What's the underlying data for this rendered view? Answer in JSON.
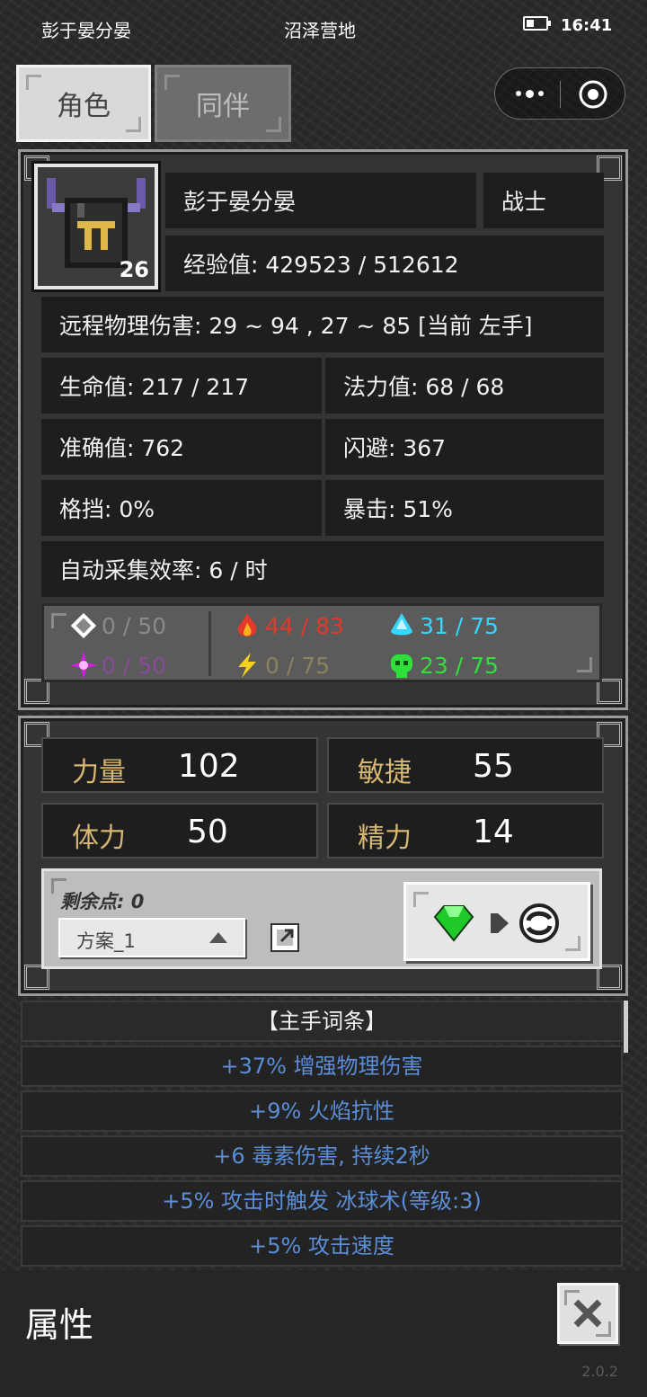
{
  "status_bar": {
    "app_title": "彭于晏分晏",
    "location": "沼泽营地",
    "time": "16:41"
  },
  "tabs": [
    {
      "label": "角色",
      "active": true
    },
    {
      "label": "同伴",
      "active": false
    }
  ],
  "character": {
    "name": "彭于晏分晏",
    "class": "战士",
    "level": "26",
    "exp": "经验值: 429523 / 512612",
    "damage": "远程物理伤害: 29 ~ 94 , 27 ~ 85 [当前 左手]",
    "hp": "生命值: 217 / 217",
    "mp": "法力值: 68 / 68",
    "accuracy": "准确值: 762",
    "dodge": "闪避: 367",
    "block": "格挡: 0%",
    "crit": "暴击: 51%",
    "gather": "自动采集效率: 6 / 时"
  },
  "resistances": [
    {
      "icon": "physical-resist-icon",
      "value": "0 / 50",
      "color": "#8a8a8a"
    },
    {
      "icon": "fire-icon",
      "value": "44 / 83",
      "color": "#e23a2a"
    },
    {
      "icon": "ice-drop-icon",
      "value": "31 / 75",
      "color": "#35d6ff"
    },
    {
      "icon": "arcane-star-icon",
      "value": "0 / 50",
      "color": "#8a4a9a"
    },
    {
      "icon": "lightning-icon",
      "value": "0 / 75",
      "color": "#8a8360"
    },
    {
      "icon": "poison-skull-icon",
      "value": "23 / 75",
      "color": "#2fe03a"
    }
  ],
  "attributes": {
    "strength": {
      "label": "力量",
      "value": "102"
    },
    "agility": {
      "label": "敏捷",
      "value": "55"
    },
    "stamina": {
      "label": "体力",
      "value": "50"
    },
    "energy": {
      "label": "精力",
      "value": "14"
    }
  },
  "points": {
    "remaining": "剩余点: 0",
    "plan": "方案_1"
  },
  "affixes": {
    "header": "【主手词条】",
    "items": [
      "+37% 增强物理伤害",
      "+9% 火焰抗性",
      "+6 毒素伤害, 持续2秒",
      "+5% 攻击时触发 冰球术(等级:3)",
      "+5% 攻击速度"
    ]
  },
  "footer": {
    "title": "属性",
    "version": "2.0.2"
  }
}
